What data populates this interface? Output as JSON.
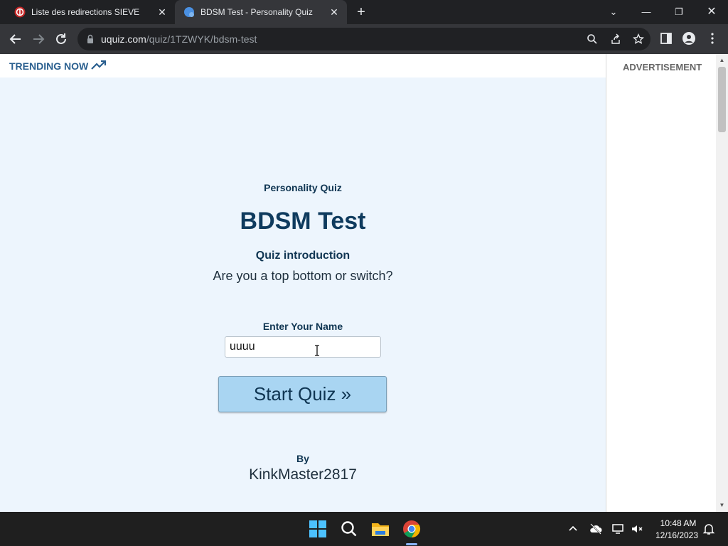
{
  "browser": {
    "tabs": [
      {
        "title": "Liste des redirections SIEVE",
        "active": false
      },
      {
        "title": "BDSM Test - Personality Quiz",
        "active": true
      }
    ],
    "url_host": "uquiz.com",
    "url_path": "/quiz/1TZWYK/bdsm-test",
    "accent": "#8ab4f8"
  },
  "page": {
    "trending_label": "TRENDING NOW",
    "ad_label": "ADVERTISEMENT",
    "quiz_type": "Personality Quiz",
    "quiz_title": "BDSM Test",
    "intro_heading": "Quiz introduction",
    "intro_text": "Are you a top bottom or switch?",
    "name_label": "Enter Your Name",
    "name_value": "uuuu",
    "start_button": "Start Quiz »",
    "by_label": "By",
    "author": "KinkMaster2817",
    "background_color": "#edf5fd",
    "button_color": "#a9d5f2",
    "title_color": "#0f3b5e"
  },
  "taskbar": {
    "apps": [
      "windows-start-icon",
      "search-icon",
      "file-explorer-icon",
      "chrome-icon"
    ],
    "time": "10:48 AM",
    "date": "12/16/2023"
  }
}
